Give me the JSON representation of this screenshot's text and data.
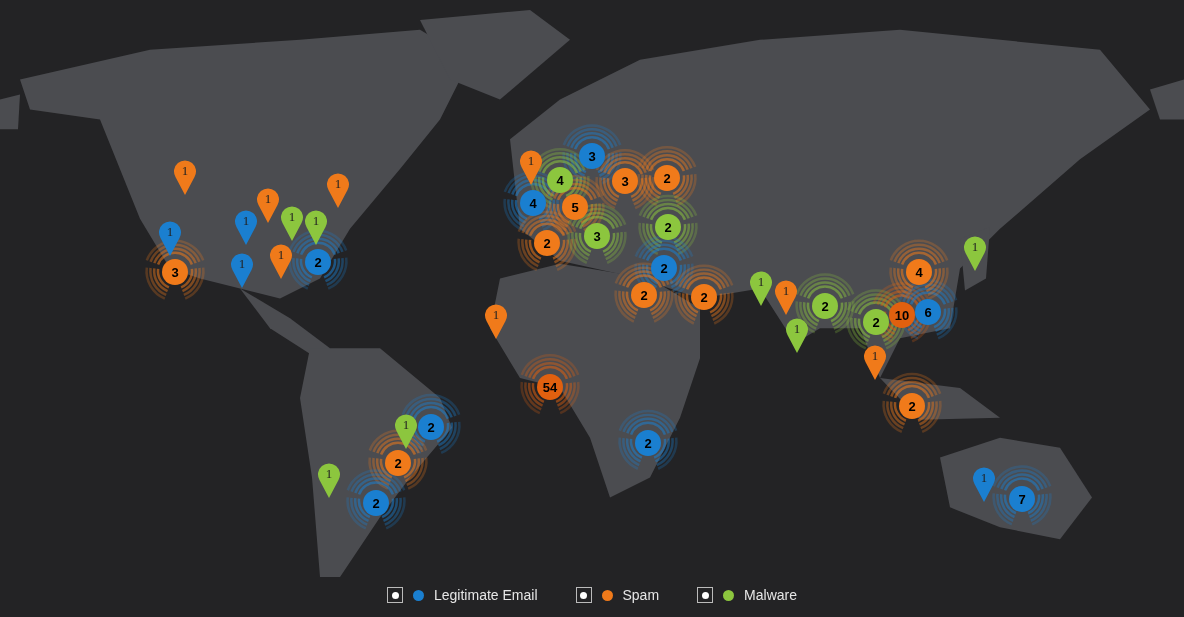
{
  "map": {
    "markers": [
      {
        "kind": "pin",
        "color": "#f07a1a",
        "count": "1"
      },
      {
        "kind": "pin",
        "color": "#1a7fd0",
        "count": "1"
      },
      {
        "kind": "cluster",
        "color": "#f07a1a",
        "count": "3"
      },
      {
        "kind": "pin",
        "color": "#1a7fd0",
        "count": "1"
      },
      {
        "kind": "pin",
        "color": "#f07a1a",
        "count": "1"
      },
      {
        "kind": "pin",
        "color": "#8cc63e",
        "count": "1"
      },
      {
        "kind": "pin",
        "color": "#f07a1a",
        "count": "1"
      },
      {
        "kind": "pin",
        "color": "#1a7fd0",
        "count": "1"
      },
      {
        "kind": "pin",
        "color": "#f07a1a",
        "count": "1"
      },
      {
        "kind": "pin",
        "color": "#8cc63e",
        "count": "1"
      },
      {
        "kind": "cluster",
        "color": "#1a7fd0",
        "count": "2"
      },
      {
        "kind": "pin",
        "color": "#f07a1a",
        "count": "1"
      },
      {
        "kind": "cluster",
        "color": "#1a7fd0",
        "count": "3"
      },
      {
        "kind": "cluster",
        "color": "#1a7fd0",
        "count": "4"
      },
      {
        "kind": "cluster",
        "color": "#8cc63e",
        "count": "4"
      },
      {
        "kind": "cluster",
        "color": "#f07a1a",
        "count": "5"
      },
      {
        "kind": "cluster",
        "color": "#f07a1a",
        "count": "3"
      },
      {
        "kind": "cluster",
        "color": "#f07a1a",
        "count": "2"
      },
      {
        "kind": "cluster",
        "color": "#f07a1a",
        "count": "2"
      },
      {
        "kind": "cluster",
        "color": "#8cc63e",
        "count": "3"
      },
      {
        "kind": "cluster",
        "color": "#8cc63e",
        "count": "2"
      },
      {
        "kind": "cluster",
        "color": "#1a7fd0",
        "count": "2"
      },
      {
        "kind": "cluster",
        "color": "#f07a1a",
        "count": "2"
      },
      {
        "kind": "cluster",
        "color": "#f07a1a",
        "count": "2"
      },
      {
        "kind": "pin",
        "color": "#f07a1a",
        "count": "1"
      },
      {
        "kind": "cluster",
        "color": "#e0600f",
        "count": "54"
      },
      {
        "kind": "pin",
        "color": "#8cc63e",
        "count": "1"
      },
      {
        "kind": "pin",
        "color": "#f07a1a",
        "count": "1"
      },
      {
        "kind": "pin",
        "color": "#8cc63e",
        "count": "1"
      },
      {
        "kind": "cluster",
        "color": "#8cc63e",
        "count": "2"
      },
      {
        "kind": "cluster",
        "color": "#8cc63e",
        "count": "2"
      },
      {
        "kind": "cluster",
        "color": "#e0600f",
        "count": "10"
      },
      {
        "kind": "cluster",
        "color": "#1a7fd0",
        "count": "6"
      },
      {
        "kind": "cluster",
        "color": "#f07a1a",
        "count": "4"
      },
      {
        "kind": "pin",
        "color": "#8cc63e",
        "count": "1"
      },
      {
        "kind": "pin",
        "color": "#f07a1a",
        "count": "1"
      },
      {
        "kind": "cluster",
        "color": "#f07a1a",
        "count": "2"
      },
      {
        "kind": "pin",
        "color": "#1a7fd0",
        "count": "1"
      },
      {
        "kind": "cluster",
        "color": "#1a7fd0",
        "count": "7"
      },
      {
        "kind": "cluster",
        "color": "#1a7fd0",
        "count": "2"
      },
      {
        "kind": "pin",
        "color": "#8cc63e",
        "count": "1"
      },
      {
        "kind": "cluster",
        "color": "#f07a1a",
        "count": "2"
      },
      {
        "kind": "pin",
        "color": "#8cc63e",
        "count": "1"
      },
      {
        "kind": "cluster",
        "color": "#1a7fd0",
        "count": "2"
      },
      {
        "kind": "cluster",
        "color": "#1a7fd0",
        "count": "2"
      }
    ]
  },
  "legend": [
    {
      "label": "Legitimate Email",
      "color": "#1a7fd0",
      "checked": true
    },
    {
      "label": "Spam",
      "color": "#f07a1a",
      "checked": true
    },
    {
      "label": "Malware",
      "color": "#8cc63e",
      "checked": true
    }
  ]
}
